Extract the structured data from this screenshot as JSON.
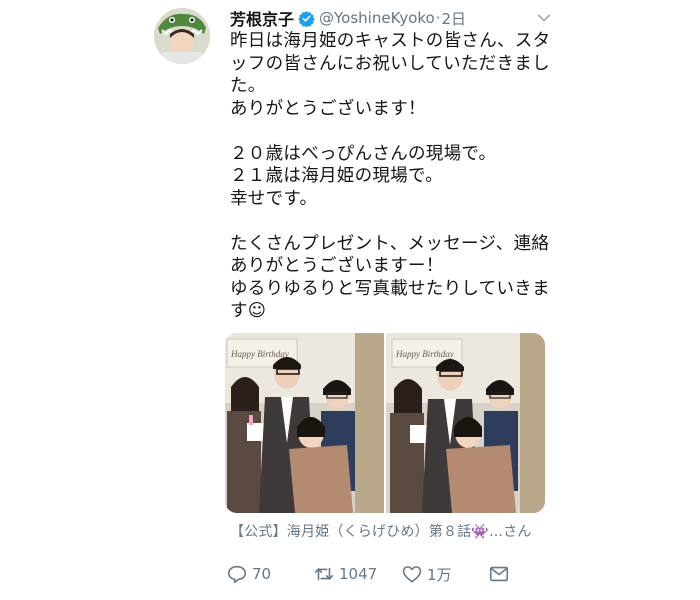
{
  "tweet": {
    "display_name": "芳根京子",
    "handle": "@YoshineKyoko",
    "separator": "·",
    "time": "2日",
    "verified_icon": "verified-badge-icon",
    "text_lines": [
      "昨日は海月姫のキャストの皆さん、スタ",
      "ッフの皆さんにお祝いしていただきまし",
      "た。",
      "ありがとうございます！",
      "",
      "２０歳はべっぴんさんの現場で。",
      "２１歳は海月姫の現場で。",
      "幸せです。",
      "",
      "たくさんプレゼント、メッセージ、連絡",
      "ありがとうございますー！",
      "ゆるりゆるりと写真載せたりしていきま",
      "す☺"
    ],
    "photo_sign_text": "Happy Birthday",
    "card_title": "【公式】海月姫（くらげひめ）第８話👾…さん",
    "actions": {
      "reply_count": "70",
      "retweet_count": "1047",
      "like_count": "1万"
    }
  },
  "colors": {
    "text": "#14171a",
    "secondary": "#657786",
    "verified": "#1da1f2"
  }
}
